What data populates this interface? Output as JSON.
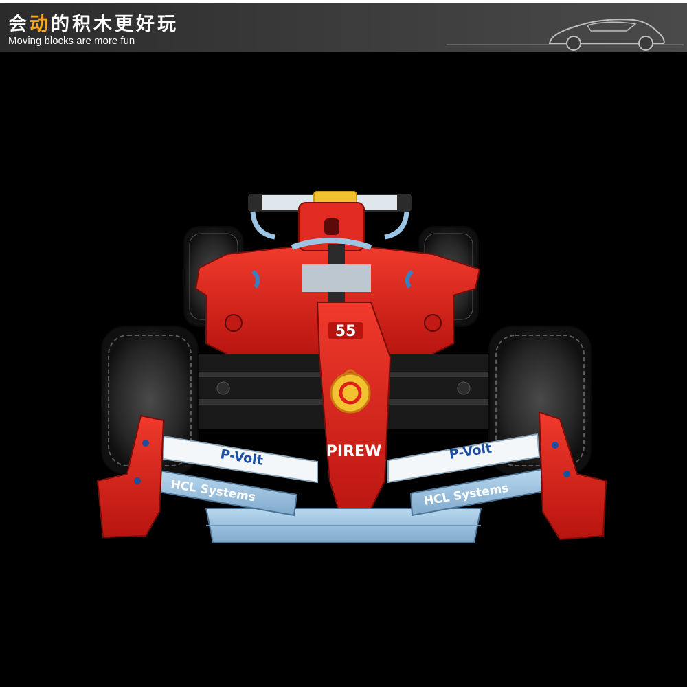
{
  "banner": {
    "title_lead": "会",
    "title_accent": "动",
    "title_rest": "的积木更好玩",
    "subtitle": "Moving blocks are more fun",
    "accent_color": "#f5a623"
  },
  "car": {
    "number": "55",
    "nose_sponsor": "PIREW",
    "left_wing_sponsor": "P-Volt",
    "right_wing_sponsor": "P-Volt",
    "left_endplate_sponsor": "HCL Systems",
    "right_endplate_sponsor": "HCL Systems",
    "body_color": "#e0201b",
    "wing_color": "#9cc4e4",
    "helmet_color": "#f2c230"
  },
  "icons": {
    "banner_car": "car-outline-icon",
    "emblem": "flame-emblem-icon"
  }
}
